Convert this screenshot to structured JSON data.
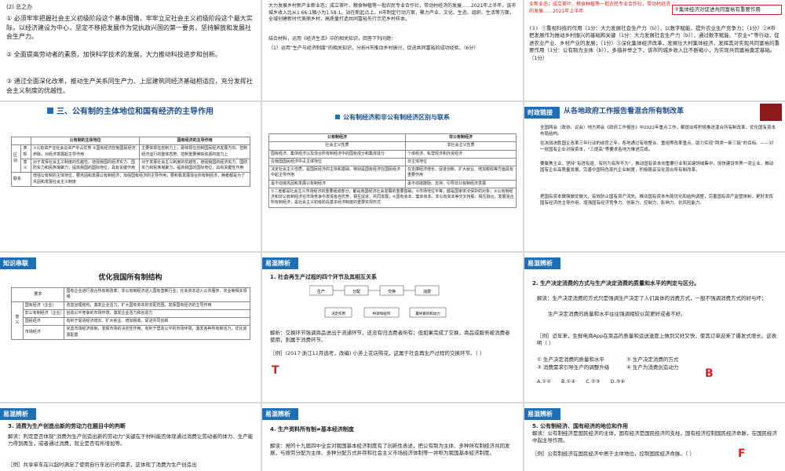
{
  "t1": {
    "top": "(2) 总之办",
    "p1": "① 必须牢牢把握社会主义初级阶段这个基本国情，牢牢立足社会主义初级阶段这个最大实际，以经济建设为中心，坚定不移把发展作为党执政兴国的第一要务，坚持解放和发展社会生产力。",
    "p2": "② 全面提高劳动者的素质，加快科学技术的发展，大力推动科技进步和创新。",
    "p3": "③ 通过全面深化改革，推动生产关系同生产力、上层建筑同经济基础相适应，充分发挥社会主义制度的优越性。"
  },
  "t2": {
    "p1": "大力发展乡村新产业新业态；成立茶叶、粮食种植等一批农民专业合作社，带动村经济的发展……2021年上半年，该市城乡收入比从1.66:1缩小为1.58:1。站在新起点上，H市制定行动方案，聚力产业、文化、生态、组织、生活等方面，全域创建新时代美丽乡村，高质量打造共同富裕先行示范乡村样本。",
    "p2": "结合材料，运用《经济生活》中的相关知识，回答下列问题：",
    "p3": "（1）运用“生产与经济制度”的相关知识，分析H市推动乡村振兴，促进共同富裕的成功经验。（6分）"
  },
  "t3": {
    "p0": "业新业态；成立茶叶、粮食种植等一批农民专业合作社，带动村经济的发展……2021年上半年",
    "tag": "③集体经济对促进共同富裕有重要作用",
    "p1": "(1) ①重视科技的作用（1分：大力发展社会生产力（b）），以数字赋能，提升农业生产竞争力；（1分）②H市把发展作为推动乡村振兴的基础和关键（1分：大力发展社会生产力（b）），通过数字赋能、“农业+”等行动，促进农业产业、乡村产业的发展；（1分）③深化集体经济改革，发展壮大村集体经济，发挥其对实现共同富裕的重要作用（1分：公有制为主体（b）），多措并举之下，该市的城乡收入比不断缩小，为实现共同富裕奠定基础。（1分）"
  },
  "t4": {
    "title": "三、公有制的主体地位和国有经济的主导作用",
    "col1": "公有制的主体地位",
    "col2": "国有经济的主导作用",
    "rowgroup": "区别",
    "r1h": "表现",
    "r1a": "①公有资产在社会总资产中占优势 ②国有经济控制国民经济命脉，对经济发展起主导作用",
    "r1b": "主要体现在控制力上，即体现在控制国民经济发展方向、控制经济运行的整体态势、控制重要稀缺资源的能力上",
    "r2h": "意义",
    "r2a": "对于发挥社会主义制度的优越性，增强我国的经济实力、国防实力和民族凝聚力，提高我国的国际地位，具有关键作用",
    "r2b": "对于发挥社会主义制度的优越性，增强我国的经济实力、国防实力和民族凝聚力，提高我国的国际地位，具有关键性作用",
    "r3h": "联系",
    "r3": "增强公有制的主体地位，要巩固和发展公有制经济；加强国有经济的主导作用，要积极发展混合所有制经济，两者都是为了巩固和发展社会主义制度"
  },
  "t5": {
    "title": "公有制经济和非公有制经济区别与联系",
    "h1": "公有制经济",
    "h2": "非公有制经济",
    "s1": "社会主义性质",
    "s2": "非社会主义性质",
    "r1a": "国有经济、集体经济以及混合所有制经济中的国有成分和集体成分",
    "r1b": "个体经济、私营经济和外资经济",
    "r2a": "在我国国民经济中占主体地位",
    "r2b": "非主体地位",
    "r3a": "决定社会主义性质，是国民经济的主体和基础，特别是国有经济在国民经济中起主导作用",
    "r3b": "在支撑经济增长、促进创新、扩大就业、增加税收等方面具有重要作用",
    "r4a": "毫不动摇巩固和发展公有制经济",
    "r4b": "毫不动摇鼓励、支持、引导非公有制经济发展",
    "note": "①二者都是社会主义市场经济的重要组成部分，都是我国经济社会发展的重要基础；②市场地位平等，都是国家依法保护的对象；③公有制经济和非公有制经济在市场竞争中发挥各自优势，相互促进、共同发展；④国有资本、集体资本、非公有资本等交叉持股、相互融合，发展混合所有制经济，是社会主义初级阶段基本经济制度的重要实现形式"
  },
  "t6": {
    "badge": "时政链接",
    "title": "从各地政府工作报告看混合所有制改革",
    "p1": "全国两会（政协、议会）地方两会《政府工作报告》中2022年重点工作，都提出将积极推进混合所有制改革，优化国有资本布局结构。",
    "p2": "在决战决胜国企改革三年行动的收官之年，各地通过有效整合、重组等改革重点，助力实现“两类一新三链”的目标。——对一批国有企业对接资本，“三提高”等要求各地方推进完成。",
    "p3": "要聚焦主业，坚持“有进有退、有所为有所不为”，推动国有资本向重要行业和关键领域集中，加快建设世界一流企业，推动国有企业高质量发展，完善中国特色现代企业制度，积极稳妥深化混合所有制改革。",
    "p4": "把国有资本做强做优做大，有效防止国有资产流失。推动国有资本布局优化和结构调整，完善国有资产监管体制，更好发挥国有经济的主导作用，增强国有经济竞争力、创新力、控制力、影响力、抗风险能力。"
  },
  "t7": {
    "badge": "知识串联",
    "title": "优化我国所有制结构",
    "r1h": "要求",
    "r1": "国有企业进行混合所有制改革；非公有制经济进入国有垄断行业；社会资本进入公共服务、农业等相关领域",
    "vgroup": "意义",
    "r2h": "国有经济（企业）",
    "r2": "改善治理结构，激发企业活力，扩大国有资本的支配范围，发挥国有经济的主导作用",
    "r3h": "非公有制经济（企业）",
    "r3": "创造公平竞争的市场环境，激发企业活力和创造力",
    "r4h": "国民经济",
    "r4": "有利于促进经济增长、扩大就业、增加税收、促进共同创新",
    "r5h": "市场经济",
    "r5": "完善市场经济体制，发挥市场的决定性作用，有利于营造公平的市场环境，激发各种所有制活力，优化资源配置"
  },
  "t8": {
    "badge": "易混辨析",
    "title": "1. 社会再生产过程的四个环节及其相互关系",
    "n1": "生产",
    "n2": "分配",
    "n3": "交换",
    "n4": "消费",
    "b1": "决定作用",
    "b2": "桥梁和纽带",
    "b3": "最终目的和动力",
    "jiexi": "解析：交换环节强调商品进出于流通环节，还没有归消费者所有；但如果完成了交换，商品或服务被消费者使用，则属于消费环节。",
    "li": "［例］(2017·浙江11月选考，改编) 小芳上花店购花，这属于社会再生产过程的交换环节。（  ）",
    "answer": "T"
  },
  "t9": {
    "badge": "易混辨析",
    "title": "2. 生产决定消费的方式与生产决定消费的质量和水平的判定与区分。",
    "j1": "解读：生产决定消费的方式只是强调生产决定了人们具体的消费方式，一般不强调消费方式的好与坏；",
    "j2": "生产决定消费的质量和水平往往强调相较以前更好或者不好。",
    "li": "［例］近年来，生鲜电商App在菜品的质量和运送速度上做到又好又快，使其订单迎来了爆发式增长。这表明（    ）",
    "o1": "① 生产决定消费的质量和水平",
    "o2": "② 生产决定消费的方式",
    "o3": "③ 消费需求引导生产的调整升级",
    "o4": "④ 生产为消费创造动力",
    "choices": "A.①②　　B.①④　　C.②③　　D.③④",
    "answer": "B"
  },
  "t10": {
    "badge": "易混辨析",
    "title": "3. 消费为生产创造出新的劳动力在题目中的判断",
    "j1": "解读：判定是否体现“消费为生产创造出新的劳动力”关键在于材料能否体现通过消费让劳动者的体力、生产能力得到再生，或者通过消费，就业是否有所增加等。",
    "li": "［例］共享单车在兴起时满足了使用自行车出行的需求，这体现了消费为生产创造出"
  },
  "t11": {
    "badge": "易混辨析",
    "title": "4. 生产资料所有制≠基本经济制度",
    "j1": "解读：党的十九届四中全会对我国基本经济制度有了创新性表述，把公有制为主体、多种所有制经济共同发展，与按劳分配为主体、多种分配方式并存和社会主义市场经济体制等一并称为我国基本经济制度。"
  },
  "t12": {
    "badge": "易混辨析",
    "title": "5. 公有制经济、国有经济的地位和作用",
    "j1": "解读：公有制经济是国民经济的主体，国有经济是国民经济的支柱，国有经济控制国民经济命脉，在国民经济中起主导作用。",
    "li": "［例］公有制经济在国民经济中居于主体地位，控制国民经济命脉。（  ）",
    "answer": "F"
  }
}
